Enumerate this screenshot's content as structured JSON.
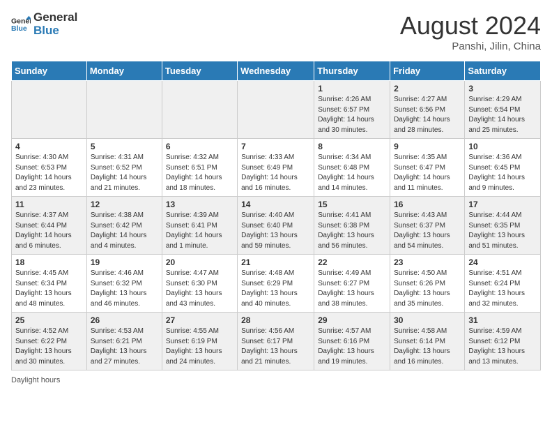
{
  "header": {
    "logo_general": "General",
    "logo_blue": "Blue",
    "month_year": "August 2024",
    "location": "Panshi, Jilin, China"
  },
  "days_of_week": [
    "Sunday",
    "Monday",
    "Tuesday",
    "Wednesday",
    "Thursday",
    "Friday",
    "Saturday"
  ],
  "weeks": [
    [
      {
        "day": "",
        "info": ""
      },
      {
        "day": "",
        "info": ""
      },
      {
        "day": "",
        "info": ""
      },
      {
        "day": "",
        "info": ""
      },
      {
        "day": "1",
        "info": "Sunrise: 4:26 AM\nSunset: 6:57 PM\nDaylight: 14 hours and 30 minutes."
      },
      {
        "day": "2",
        "info": "Sunrise: 4:27 AM\nSunset: 6:56 PM\nDaylight: 14 hours and 28 minutes."
      },
      {
        "day": "3",
        "info": "Sunrise: 4:29 AM\nSunset: 6:54 PM\nDaylight: 14 hours and 25 minutes."
      }
    ],
    [
      {
        "day": "4",
        "info": "Sunrise: 4:30 AM\nSunset: 6:53 PM\nDaylight: 14 hours and 23 minutes."
      },
      {
        "day": "5",
        "info": "Sunrise: 4:31 AM\nSunset: 6:52 PM\nDaylight: 14 hours and 21 minutes."
      },
      {
        "day": "6",
        "info": "Sunrise: 4:32 AM\nSunset: 6:51 PM\nDaylight: 14 hours and 18 minutes."
      },
      {
        "day": "7",
        "info": "Sunrise: 4:33 AM\nSunset: 6:49 PM\nDaylight: 14 hours and 16 minutes."
      },
      {
        "day": "8",
        "info": "Sunrise: 4:34 AM\nSunset: 6:48 PM\nDaylight: 14 hours and 14 minutes."
      },
      {
        "day": "9",
        "info": "Sunrise: 4:35 AM\nSunset: 6:47 PM\nDaylight: 14 hours and 11 minutes."
      },
      {
        "day": "10",
        "info": "Sunrise: 4:36 AM\nSunset: 6:45 PM\nDaylight: 14 hours and 9 minutes."
      }
    ],
    [
      {
        "day": "11",
        "info": "Sunrise: 4:37 AM\nSunset: 6:44 PM\nDaylight: 14 hours and 6 minutes."
      },
      {
        "day": "12",
        "info": "Sunrise: 4:38 AM\nSunset: 6:42 PM\nDaylight: 14 hours and 4 minutes."
      },
      {
        "day": "13",
        "info": "Sunrise: 4:39 AM\nSunset: 6:41 PM\nDaylight: 14 hours and 1 minute."
      },
      {
        "day": "14",
        "info": "Sunrise: 4:40 AM\nSunset: 6:40 PM\nDaylight: 13 hours and 59 minutes."
      },
      {
        "day": "15",
        "info": "Sunrise: 4:41 AM\nSunset: 6:38 PM\nDaylight: 13 hours and 56 minutes."
      },
      {
        "day": "16",
        "info": "Sunrise: 4:43 AM\nSunset: 6:37 PM\nDaylight: 13 hours and 54 minutes."
      },
      {
        "day": "17",
        "info": "Sunrise: 4:44 AM\nSunset: 6:35 PM\nDaylight: 13 hours and 51 minutes."
      }
    ],
    [
      {
        "day": "18",
        "info": "Sunrise: 4:45 AM\nSunset: 6:34 PM\nDaylight: 13 hours and 48 minutes."
      },
      {
        "day": "19",
        "info": "Sunrise: 4:46 AM\nSunset: 6:32 PM\nDaylight: 13 hours and 46 minutes."
      },
      {
        "day": "20",
        "info": "Sunrise: 4:47 AM\nSunset: 6:30 PM\nDaylight: 13 hours and 43 minutes."
      },
      {
        "day": "21",
        "info": "Sunrise: 4:48 AM\nSunset: 6:29 PM\nDaylight: 13 hours and 40 minutes."
      },
      {
        "day": "22",
        "info": "Sunrise: 4:49 AM\nSunset: 6:27 PM\nDaylight: 13 hours and 38 minutes."
      },
      {
        "day": "23",
        "info": "Sunrise: 4:50 AM\nSunset: 6:26 PM\nDaylight: 13 hours and 35 minutes."
      },
      {
        "day": "24",
        "info": "Sunrise: 4:51 AM\nSunset: 6:24 PM\nDaylight: 13 hours and 32 minutes."
      }
    ],
    [
      {
        "day": "25",
        "info": "Sunrise: 4:52 AM\nSunset: 6:22 PM\nDaylight: 13 hours and 30 minutes."
      },
      {
        "day": "26",
        "info": "Sunrise: 4:53 AM\nSunset: 6:21 PM\nDaylight: 13 hours and 27 minutes."
      },
      {
        "day": "27",
        "info": "Sunrise: 4:55 AM\nSunset: 6:19 PM\nDaylight: 13 hours and 24 minutes."
      },
      {
        "day": "28",
        "info": "Sunrise: 4:56 AM\nSunset: 6:17 PM\nDaylight: 13 hours and 21 minutes."
      },
      {
        "day": "29",
        "info": "Sunrise: 4:57 AM\nSunset: 6:16 PM\nDaylight: 13 hours and 19 minutes."
      },
      {
        "day": "30",
        "info": "Sunrise: 4:58 AM\nSunset: 6:14 PM\nDaylight: 13 hours and 16 minutes."
      },
      {
        "day": "31",
        "info": "Sunrise: 4:59 AM\nSunset: 6:12 PM\nDaylight: 13 hours and 13 minutes."
      }
    ]
  ],
  "footer": {
    "daylight_label": "Daylight hours"
  }
}
